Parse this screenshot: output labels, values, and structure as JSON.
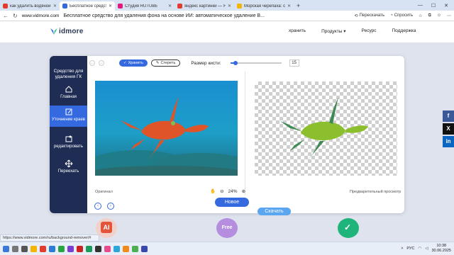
{
  "browser": {
    "tabs": [
      {
        "title": "как удалить водяной знак",
        "favicon_color": "#e33b2e",
        "active": false
      },
      {
        "title": "Бесплатное средство для уд",
        "favicon_color": "#3569e0",
        "active": true
      },
      {
        "title": "Студия RUTUBE",
        "favicon_color": "#e2197a",
        "active": false
      },
      {
        "title": "яндекс картинки — Яндекс",
        "favicon_color": "#e33b2e",
        "active": false
      },
      {
        "title": "Морская черепаха: смотр",
        "favicon_color": "#f5b400",
        "active": false
      }
    ],
    "url_domain": "www.vidmore.com",
    "page_title": "Бесплатное средство для удаления фона на основе ИИ: автоматическое удаление В...",
    "translate_label": "Перескачать",
    "ask_label": "Спросить",
    "status_url": "https://www.vidmore.com/ru/background-remover/#"
  },
  "site": {
    "logo_text": "idmore",
    "nav": [
      "хранить",
      "Продукты",
      "Ресурс",
      "Поддержка"
    ]
  },
  "tool": {
    "sidebar_heading": "Средство для удаления ГК",
    "sidebar_items": [
      {
        "label": "Главная",
        "icon": "home-icon"
      },
      {
        "label": "Уточнение краев",
        "icon": "edit-icon"
      },
      {
        "label": "редактировать",
        "icon": "crop-icon"
      },
      {
        "label": "Переехать",
        "icon": "move-icon"
      }
    ],
    "keep_label": "Хранить",
    "erase_label": "Стереть",
    "brush_label": "Размер кисти:",
    "brush_value": "15",
    "brush_fraction": 0.1,
    "original_label": "Оригинал",
    "preview_label": "Предварительный просмотр",
    "zoom": "24%",
    "new_label": "Новое",
    "download_label": "Скачать"
  },
  "share": [
    {
      "icon": "facebook-icon",
      "glyph": "f",
      "color": "#3b5998"
    },
    {
      "icon": "x-icon",
      "glyph": "X",
      "color": "#111111"
    },
    {
      "icon": "linkedin-icon",
      "glyph": "in",
      "color": "#0a66c2"
    }
  ],
  "taskbar": {
    "lang": "РУС",
    "time": "10:38",
    "date": "30.06.2025"
  }
}
